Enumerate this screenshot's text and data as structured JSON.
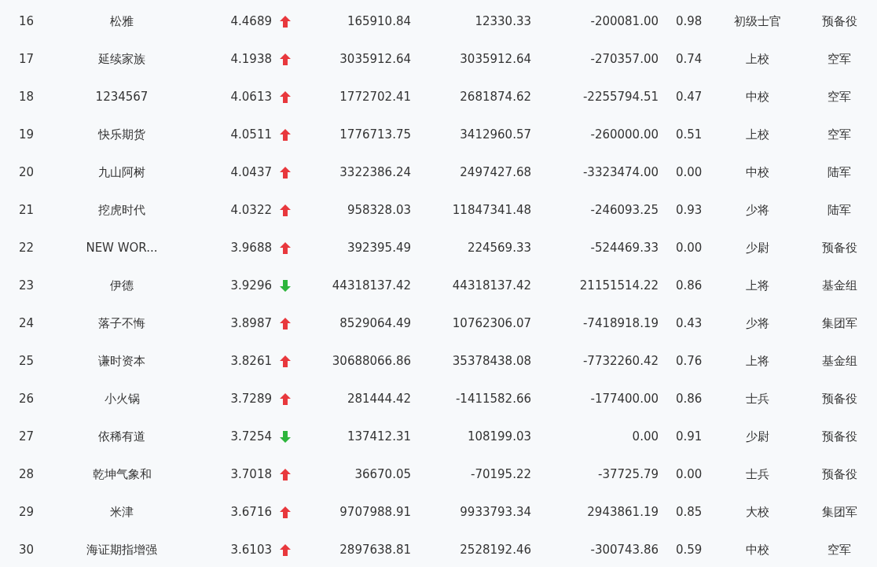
{
  "rows": [
    {
      "rank": "16",
      "name": "松雅",
      "score": "4.4689",
      "kind": "up",
      "column_4": "165910.84",
      "column_5": "12330.33",
      "column_6": "-200081.00",
      "column_7": "0.98",
      "column_8": "初级士官",
      "column_9": "预备役"
    },
    {
      "rank": "17",
      "name": "延续家族",
      "score": "4.1938",
      "kind": "up",
      "column_4": "3035912.64",
      "column_5": "3035912.64",
      "column_6": "-270357.00",
      "column_7": "0.74",
      "column_8": "上校",
      "column_9": "空军"
    },
    {
      "rank": "18",
      "name": "1234567",
      "score": "4.0613",
      "kind": "up",
      "column_4": "1772702.41",
      "column_5": "2681874.62",
      "column_6": "-2255794.51",
      "column_7": "0.47",
      "column_8": "中校",
      "column_9": "空军"
    },
    {
      "rank": "19",
      "name": "快乐期货",
      "score": "4.0511",
      "kind": "up",
      "column_4": "1776713.75",
      "column_5": "3412960.57",
      "column_6": "-260000.00",
      "column_7": "0.51",
      "column_8": "上校",
      "column_9": "空军"
    },
    {
      "rank": "20",
      "name": "九山阿树",
      "score": "4.0437",
      "kind": "up",
      "column_4": "3322386.24",
      "column_5": "2497427.68",
      "column_6": "-3323474.00",
      "column_7": "0.00",
      "column_8": "中校",
      "column_9": "陆军"
    },
    {
      "rank": "21",
      "name": "挖虎时代",
      "score": "4.0322",
      "kind": "up",
      "column_4": "958328.03",
      "column_5": "11847341.48",
      "column_6": "-246093.25",
      "column_7": "0.93",
      "column_8": "少将",
      "column_9": "陆军"
    },
    {
      "rank": "22",
      "name": "NEW WOR...",
      "score": "3.9688",
      "kind": "up",
      "column_4": "392395.49",
      "column_5": "224569.33",
      "column_6": "-524469.33",
      "column_7": "0.00",
      "column_8": "少尉",
      "column_9": "预备役"
    },
    {
      "rank": "23",
      "name": "伊德",
      "score": "3.9296",
      "kind": "down",
      "column_4": "44318137.42",
      "column_5": "44318137.42",
      "column_6": "21151514.22",
      "column_7": "0.86",
      "column_8": "上将",
      "column_9": "基金组"
    },
    {
      "rank": "24",
      "name": "落子不悔",
      "score": "3.8987",
      "kind": "up",
      "column_4": "8529064.49",
      "column_5": "10762306.07",
      "column_6": "-7418918.19",
      "column_7": "0.43",
      "column_8": "少将",
      "column_9": "集团军"
    },
    {
      "rank": "25",
      "name": "谦时资本",
      "score": "3.8261",
      "kind": "up",
      "column_4": "30688066.86",
      "column_5": "35378438.08",
      "column_6": "-7732260.42",
      "column_7": "0.76",
      "column_8": "上将",
      "column_9": "基金组"
    },
    {
      "rank": "26",
      "name": "小火锅",
      "score": "3.7289",
      "kind": "up",
      "column_4": "281444.42",
      "column_5": "-1411582.66",
      "column_6": "-177400.00",
      "column_7": "0.86",
      "column_8": "士兵",
      "column_9": "预备役"
    },
    {
      "rank": "27",
      "name": "依稀有道",
      "score": "3.7254",
      "kind": "down",
      "column_4": "137412.31",
      "column_5": "108199.03",
      "column_6": "0.00",
      "column_7": "0.91",
      "column_8": "少尉",
      "column_9": "预备役"
    },
    {
      "rank": "28",
      "name": "乾坤气象和",
      "score": "3.7018",
      "kind": "up",
      "column_4": "36670.05",
      "column_5": "-70195.22",
      "column_6": "-37725.79",
      "column_7": "0.00",
      "column_8": "士兵",
      "column_9": "预备役"
    },
    {
      "rank": "29",
      "name": "米津",
      "score": "3.6716",
      "kind": "up",
      "column_4": "9707988.91",
      "column_5": "9933793.34",
      "column_6": "2943861.19",
      "column_7": "0.85",
      "column_8": "大校",
      "column_9": "集团军"
    },
    {
      "rank": "30",
      "name": "海证期指增强",
      "score": "3.6103",
      "kind": "up",
      "column_4": "2897638.81",
      "column_5": "2528192.46",
      "column_6": "-300743.86",
      "column_7": "0.59",
      "column_8": "中校",
      "column_9": "空军"
    }
  ]
}
